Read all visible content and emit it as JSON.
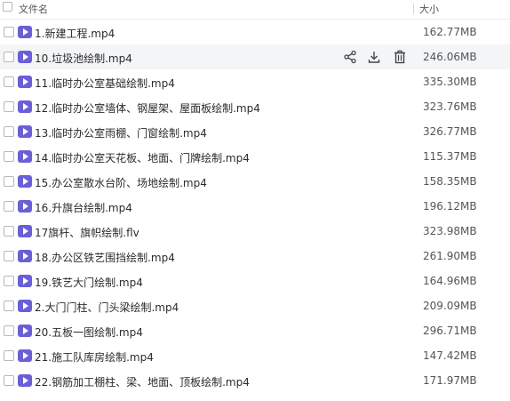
{
  "header": {
    "name_label": "文件名",
    "size_label": "大小"
  },
  "files": [
    {
      "name": "1.新建工程.mp4",
      "size": "162.77MB"
    },
    {
      "name": "10.垃圾池绘制.mp4",
      "size": "246.06MB"
    },
    {
      "name": "11.临时办公室基础绘制.mp4",
      "size": "335.30MB"
    },
    {
      "name": "12.临时办公室墙体、钢屋架、屋面板绘制.mp4",
      "size": "323.76MB"
    },
    {
      "name": "13.临时办公室雨棚、门窗绘制.mp4",
      "size": "326.77MB"
    },
    {
      "name": "14.临时办公室天花板、地面、门牌绘制.mp4",
      "size": "115.37MB"
    },
    {
      "name": "15.办公室散水台阶、场地绘制.mp4",
      "size": "158.35MB"
    },
    {
      "name": "16.升旗台绘制.mp4",
      "size": "196.12MB"
    },
    {
      "name": "17旗杆、旗帜绘制.flv",
      "size": "323.98MB"
    },
    {
      "name": "18.办公区铁艺围挡绘制.mp4",
      "size": "261.90MB"
    },
    {
      "name": "19.铁艺大门绘制.mp4",
      "size": "164.96MB"
    },
    {
      "name": "2.大门门柱、门头梁绘制.mp4",
      "size": "209.09MB"
    },
    {
      "name": "20.五板一图绘制.mp4",
      "size": "296.71MB"
    },
    {
      "name": "21.施工队库房绘制.mp4",
      "size": "147.42MB"
    },
    {
      "name": "22.钢筋加工棚柱、梁、地面、顶板绘制.mp4",
      "size": "171.97MB"
    }
  ],
  "hover_row_index": 1,
  "row_actions": [
    {
      "icon": "share-icon"
    },
    {
      "icon": "download-icon"
    },
    {
      "icon": "delete-icon"
    }
  ],
  "colors": {
    "video_icon": "#6b5fd8",
    "hover_row": "#f4f5f7"
  }
}
